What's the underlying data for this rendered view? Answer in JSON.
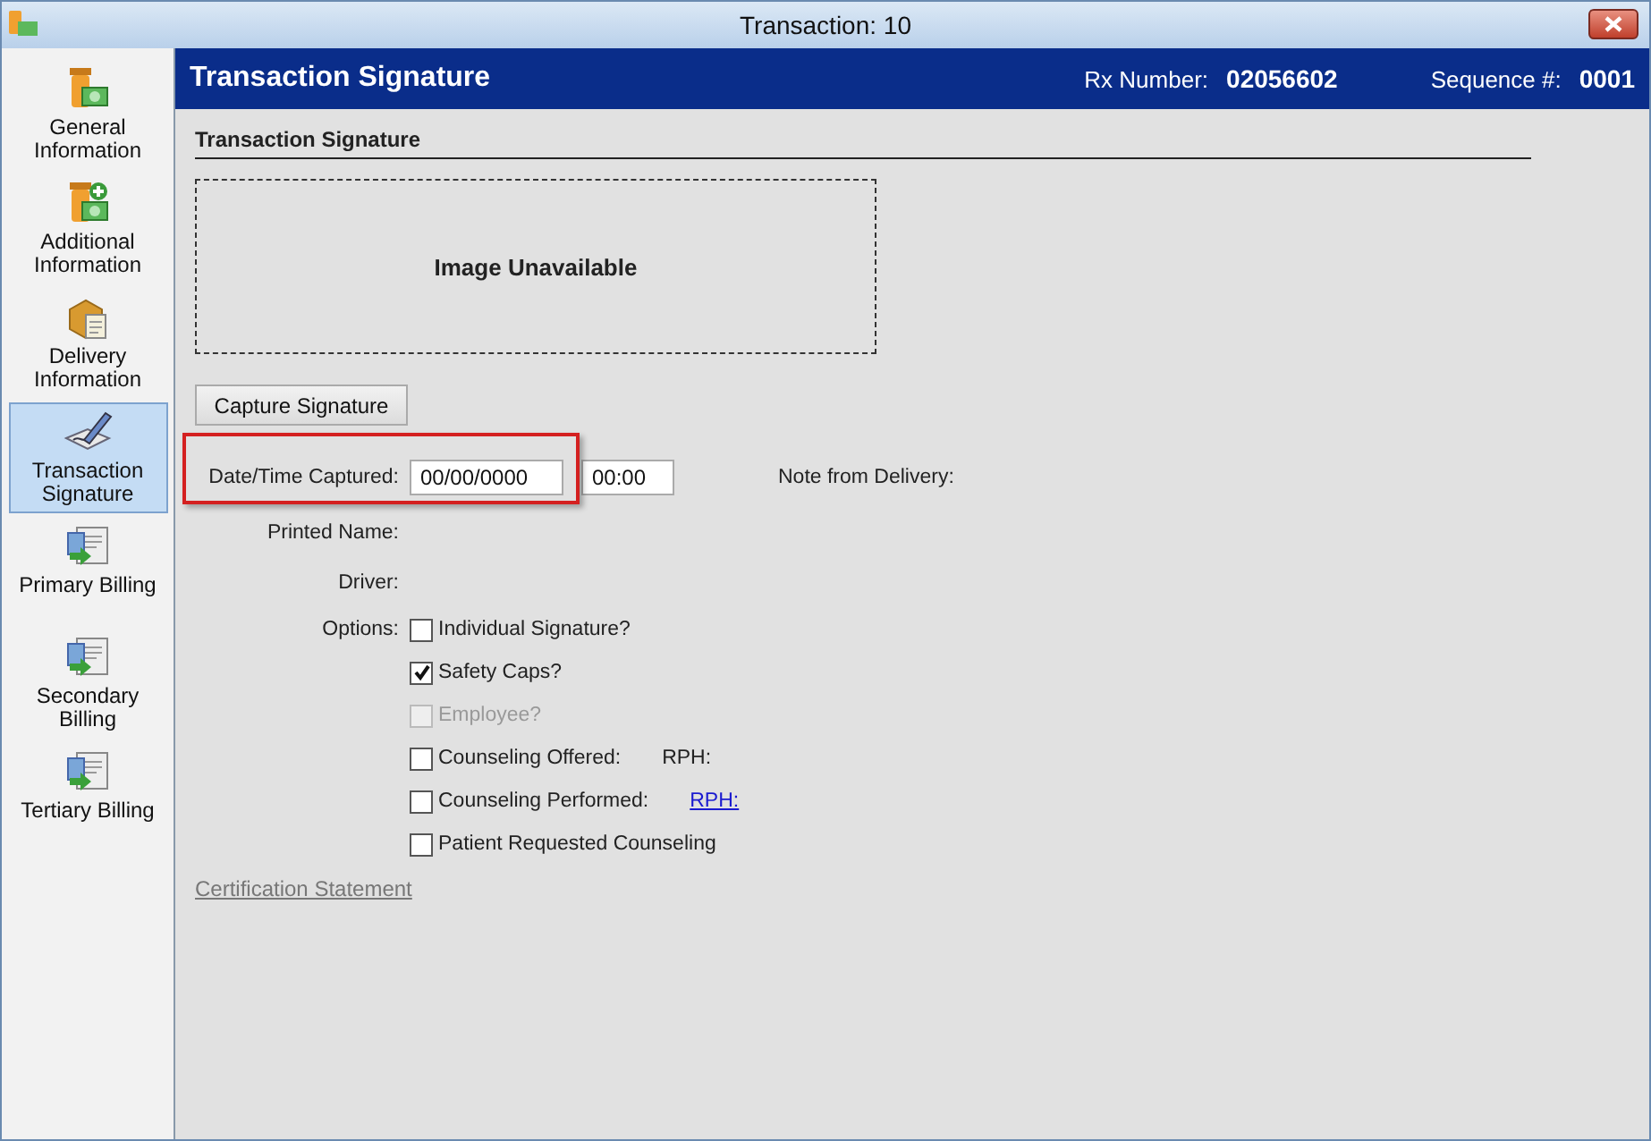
{
  "window": {
    "title": "Transaction: 10"
  },
  "sidebar": {
    "items": [
      {
        "label": "General Information",
        "kind": "bottle",
        "selected": false
      },
      {
        "label": "Additional Information",
        "kind": "add",
        "selected": false
      },
      {
        "label": "Delivery Information",
        "kind": "box",
        "selected": false
      },
      {
        "label": "Transaction Signature",
        "kind": "signature",
        "selected": true
      },
      {
        "label": "Primary Billing",
        "kind": "billing",
        "selected": false
      },
      {
        "label": "Secondary Billing",
        "kind": "billing",
        "selected": false
      },
      {
        "label": "Tertiary Billing",
        "kind": "billing",
        "selected": false
      }
    ]
  },
  "header": {
    "title": "Transaction Signature",
    "rx_label": "Rx Number:",
    "rx_value": "02056602",
    "seq_label": "Sequence #:",
    "seq_value": "0001"
  },
  "section": {
    "title": "Transaction Signature",
    "image_text": "Image Unavailable",
    "capture_button": "Capture Signature"
  },
  "date_time": {
    "label": "Date/Time Captured:",
    "date": "00/00/0000",
    "time": "00:00",
    "highlighted": true
  },
  "note_label": "Note from Delivery:",
  "printed_name_label": "Printed Name:",
  "driver_label": "Driver:",
  "options_label": "Options:",
  "options": [
    {
      "label": "Individual Signature?",
      "checked": false,
      "disabled": false
    },
    {
      "label": "Safety Caps?",
      "checked": true,
      "disabled": false
    },
    {
      "label": "Employee?",
      "checked": false,
      "disabled": true
    },
    {
      "label": "Counseling Offered:",
      "checked": false,
      "disabled": false,
      "extra": {
        "text": "RPH:",
        "link": false
      }
    },
    {
      "label": "Counseling Performed:",
      "checked": false,
      "disabled": false,
      "extra": {
        "text": "RPH:",
        "link": true
      }
    },
    {
      "label": "Patient Requested Counseling",
      "checked": false,
      "disabled": false
    }
  ],
  "certification_link": "Certification Statement"
}
